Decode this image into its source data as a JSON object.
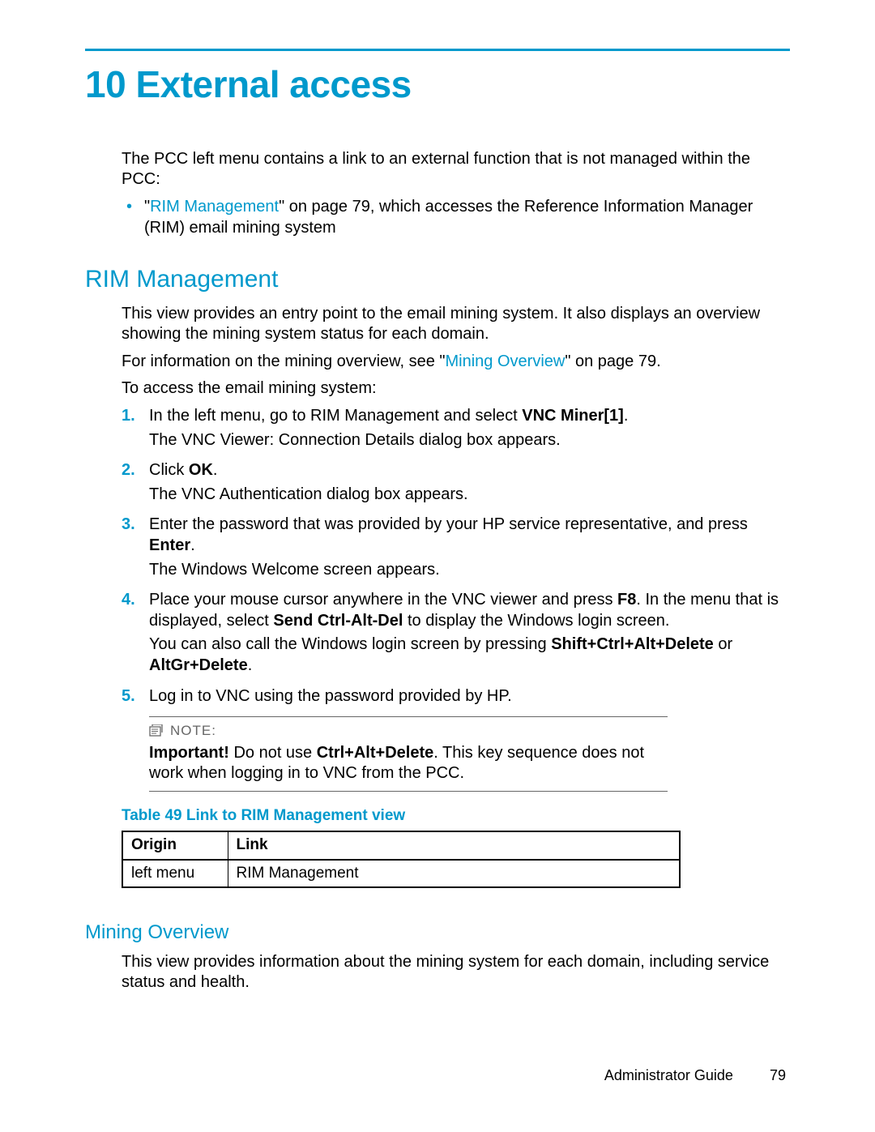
{
  "chapter": {
    "number": "10",
    "title": "External access"
  },
  "intro": {
    "para": "The PCC left menu contains a link to an external function that is not managed within the PCC:",
    "bullet_link_text": "RIM Management",
    "bullet_after": "\" on page 79, which accesses the Reference Information Manager (RIM) email mining system"
  },
  "rim": {
    "heading": "RIM Management",
    "para1": "This view provides an entry point to the email mining system. It also displays an overview showing the mining system status for each domain.",
    "para2_pre": "For information on the mining overview, see \"",
    "para2_link": "Mining Overview",
    "para2_post": "\" on page 79.",
    "para3": "To access the email mining system:",
    "steps": {
      "s1a_pre": "In the left menu, go to RIM Management and select ",
      "s1a_bold": "VNC Miner[1]",
      "s1a_post": ".",
      "s1b": "The VNC Viewer: Connection Details dialog box appears.",
      "s2a_pre": "Click ",
      "s2a_bold": "OK",
      "s2a_post": ".",
      "s2b": "The VNC Authentication dialog box appears.",
      "s3a_pre": "Enter the password that was provided by your HP service representative, and press ",
      "s3a_bold": "Enter",
      "s3a_post": ".",
      "s3b": "The Windows Welcome screen appears.",
      "s4a_pre": "Place your mouse cursor anywhere in the VNC viewer and press ",
      "s4a_bold1": "F8",
      "s4a_mid": ". In the menu that is displayed, select ",
      "s4a_bold2": "Send Ctrl-Alt-Del",
      "s4a_post": " to display the Windows login screen.",
      "s4b_pre": "You can also call the Windows login screen by pressing ",
      "s4b_bold1": "Shift+Ctrl+Alt+Delete",
      "s4b_mid": " or ",
      "s4b_bold2": "AltGr+Delete",
      "s4b_post": ".",
      "s5": "Log in to VNC using the password provided by HP."
    },
    "note": {
      "label": "NOTE:",
      "body_bold": "Important!",
      "body_pre": " Do not use ",
      "body_bold2": "Ctrl+Alt+Delete",
      "body_post": ". This key sequence does not work when logging in to VNC from the PCC."
    },
    "table": {
      "caption": "Table 49 Link to RIM Management view",
      "h1": "Origin",
      "h2": "Link",
      "r1c1": "left menu",
      "r1c2": "RIM Management"
    }
  },
  "mining": {
    "heading": "Mining Overview",
    "para": "This view provides information about the mining system for each domain, including service status and health."
  },
  "footer": {
    "doc": "Administrator Guide",
    "page": "79"
  }
}
